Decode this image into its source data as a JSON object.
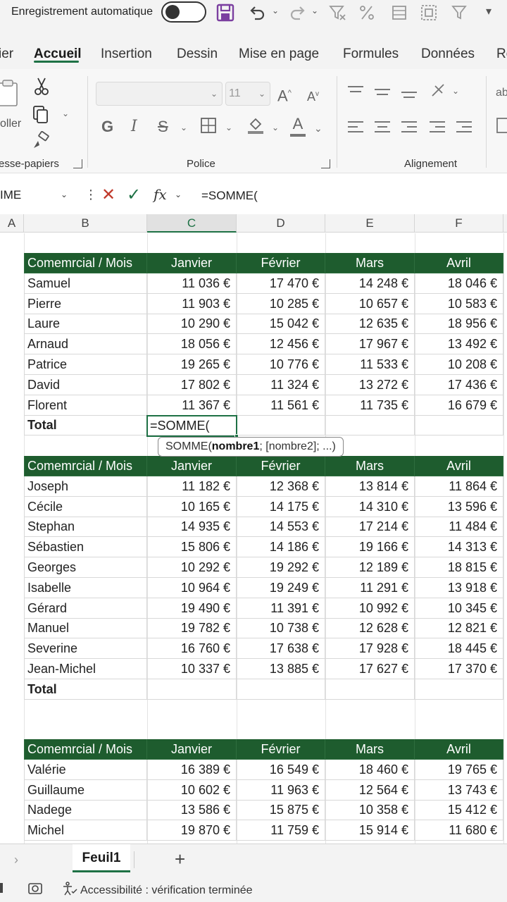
{
  "titlebar": {
    "autosave_label": "Enregistrement automatique"
  },
  "ribbon_tabs": [
    "ier",
    "Accueil",
    "Insertion",
    "Dessin",
    "Mise en page",
    "Formules",
    "Données",
    "Re"
  ],
  "ribbon": {
    "clipboard": {
      "paste_label": "oller",
      "label": "esse-papiers"
    },
    "font": {
      "name_value": "",
      "size_value": "11",
      "label": "Police",
      "bold": "G",
      "italic": "I",
      "strike": "S",
      "grow": "A",
      "shrink": "A",
      "color": "A"
    },
    "alignment": {
      "label": "Alignement"
    },
    "wrap_hint": "ab"
  },
  "formula_bar": {
    "name_box": "IME",
    "fx": "fx",
    "formula": "=SOMME("
  },
  "columns": [
    "A",
    "B",
    "C",
    "D",
    "E",
    "F"
  ],
  "active_column": "C",
  "active_cell_value": "=SOMME(",
  "tooltip": {
    "fn": "SOMME(",
    "arg1": "nombre1",
    "rest": "; [nombre2]; ...)"
  },
  "tables": [
    {
      "header": [
        "Comemrcial / Mois",
        "Janvier",
        "Février",
        "Mars",
        "Avril"
      ],
      "rows": [
        [
          "Samuel",
          "11 036 €",
          "17 470 €",
          "14 248 €",
          "18 046 €"
        ],
        [
          "Pierre",
          "11 903 €",
          "10 285 €",
          "10 657 €",
          "10 583 €"
        ],
        [
          "Laure",
          "10 290 €",
          "15 042 €",
          "12 635 €",
          "18 956 €"
        ],
        [
          "Arnaud",
          "18 056 €",
          "12 456 €",
          "17 967 €",
          "13 492 €"
        ],
        [
          "Patrice",
          "19 265 €",
          "10 776 €",
          "11 533 €",
          "10 208 €"
        ],
        [
          "David",
          "17 802 €",
          "11 324 €",
          "13 272 €",
          "17 436 €"
        ],
        [
          "Florent",
          "11 367 €",
          "11 561 €",
          "11 735 €",
          "16 679 €"
        ]
      ],
      "total_label": "Total"
    },
    {
      "header": [
        "Comemrcial / Mois",
        "Janvier",
        "Février",
        "Mars",
        "Avril"
      ],
      "rows": [
        [
          "Joseph",
          "11 182 €",
          "12 368 €",
          "13 814 €",
          "11 864 €"
        ],
        [
          "Cécile",
          "10 165 €",
          "14 175 €",
          "14 310 €",
          "13 596 €"
        ],
        [
          "Stephan",
          "14 935 €",
          "14 553 €",
          "17 214 €",
          "11 484 €"
        ],
        [
          "Sébastien",
          "15 806 €",
          "14 186 €",
          "19 166 €",
          "14 313 €"
        ],
        [
          "Georges",
          "10 292 €",
          "19 292 €",
          "12 189 €",
          "18 815 €"
        ],
        [
          "Isabelle",
          "10 964 €",
          "19 249 €",
          "11 291 €",
          "13 918 €"
        ],
        [
          "Gérard",
          "19 490 €",
          "11 391 €",
          "10 992 €",
          "10 345 €"
        ],
        [
          "Manuel",
          "19 782 €",
          "10 738 €",
          "12 628 €",
          "12 821 €"
        ],
        [
          "Severine",
          "16 760 €",
          "17 638 €",
          "17 928 €",
          "18 445 €"
        ],
        [
          "Jean-Michel",
          "10 337 €",
          "13 885 €",
          "17 627 €",
          "17 370 €"
        ]
      ],
      "total_label": "Total"
    },
    {
      "header": [
        "Comemrcial / Mois",
        "Janvier",
        "Février",
        "Mars",
        "Avril"
      ],
      "rows": [
        [
          "Valérie",
          "16 389 €",
          "16 549 €",
          "18 460 €",
          "19 765 €"
        ],
        [
          "Guillaume",
          "10 602 €",
          "11 963 €",
          "12 564 €",
          "13 743 €"
        ],
        [
          "Nadege",
          "13 586 €",
          "15 875 €",
          "10 358 €",
          "15 412 €"
        ],
        [
          "Michel",
          "19 870 €",
          "11 759 €",
          "15 914 €",
          "11 680 €"
        ]
      ],
      "total_label": ""
    }
  ],
  "sheet_tabs": {
    "active": "Feuil1",
    "add": "+"
  },
  "status": {
    "accessibility": "Accessibilité : vérification terminée"
  },
  "colors": {
    "accent": "#1e7145",
    "table_header": "#1e5c2e"
  }
}
